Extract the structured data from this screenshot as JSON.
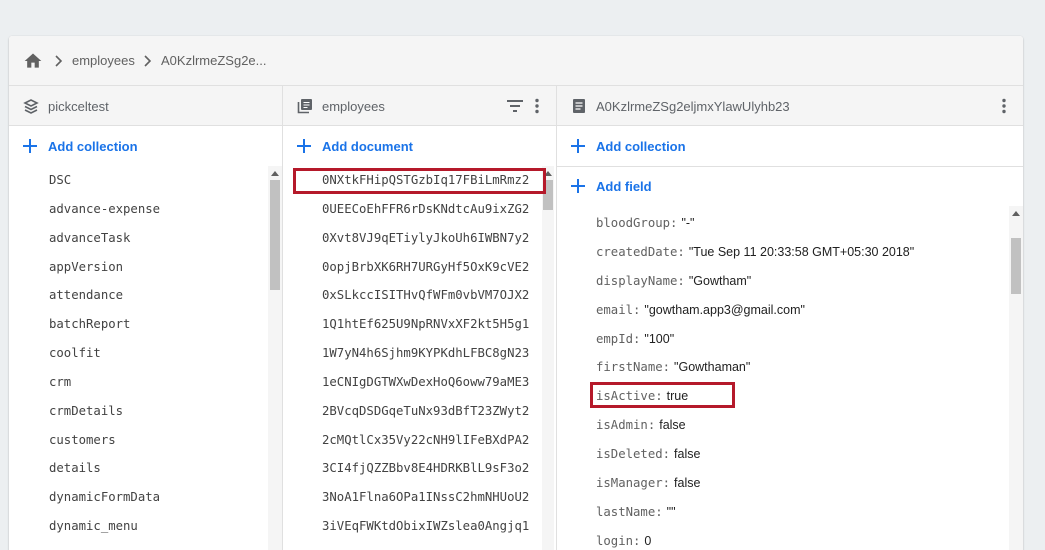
{
  "breadcrumb": {
    "home_icon": "home-icon",
    "items": [
      "employees",
      "A0KzlrmeZSg2e..."
    ]
  },
  "root_panel": {
    "title": "pickceltest",
    "icon": "database-icon",
    "add_label": "Add collection",
    "collections": [
      "DSC",
      "advance-expense",
      "advanceTask",
      "appVersion",
      "attendance",
      "batchReport",
      "coolfit",
      "crm",
      "crmDetails",
      "customers",
      "details",
      "dynamicFormData",
      "dynamic_menu"
    ]
  },
  "collection_panel": {
    "title": "employees",
    "icon": "collection-icon",
    "add_label": "Add document",
    "documents": [
      "0NXtkFHipQSTGzbIq17FBiLmRmz2",
      "0UEECoEhFFR6rDsKNdtcAu9ixZG2",
      "0Xvt8VJ9qETiylyJkoUh6IWBN7y2",
      "0opjBrbXK6RH7URGyHf5OxK9cVE2",
      "0xSLkccISITHvQfWFm0vbVM7OJX2",
      "1Q1htEf625U9NpRNVxXF2kt5H5g1",
      "1W7yN4h6Sjhm9KYPKdhLFBC8gN23",
      "1eCNIgDGTWXwDexHoQ6oww79aME3",
      "2BVcqDSDGqeTuNx93dBfT23ZWyt2",
      "2cMQtlCx35Vy22cNH9lIFeBXdPA2",
      "3CI4fjQZZBbv8E4HDRKBlL9sF3o2",
      "3NoA1Flna6OPa1INssC2hmNHUoU2",
      "3iVEqFWKtdObixIWZslea0Angjq1"
    ]
  },
  "document_panel": {
    "title": "A0KzlrmeZSg2eljmxYlawUlyhb23",
    "icon": "document-icon",
    "add_collection_label": "Add collection",
    "add_field_label": "Add field",
    "fields": [
      {
        "key": "bloodGroup:",
        "value": "\"-\""
      },
      {
        "key": "createdDate:",
        "value": "\"Tue Sep 11 20:33:58 GMT+05:30 2018\""
      },
      {
        "key": "displayName:",
        "value": "\"Gowtham\""
      },
      {
        "key": "email:",
        "value": "\"gowtham.app3@gmail.com\""
      },
      {
        "key": "empId:",
        "value": "\"100\""
      },
      {
        "key": "firstName:",
        "value": "\"Gowthaman\""
      },
      {
        "key": "isActive:",
        "value": "true"
      },
      {
        "key": "isAdmin:",
        "value": "false"
      },
      {
        "key": "isDeleted:",
        "value": "false"
      },
      {
        "key": "isManager:",
        "value": "false"
      },
      {
        "key": "lastName:",
        "value": "\"\""
      },
      {
        "key": "login:",
        "value": "0"
      }
    ]
  },
  "colors": {
    "accent": "#1a73e8",
    "highlight": "#b5192a",
    "header_bg": "#f5f5f5"
  }
}
